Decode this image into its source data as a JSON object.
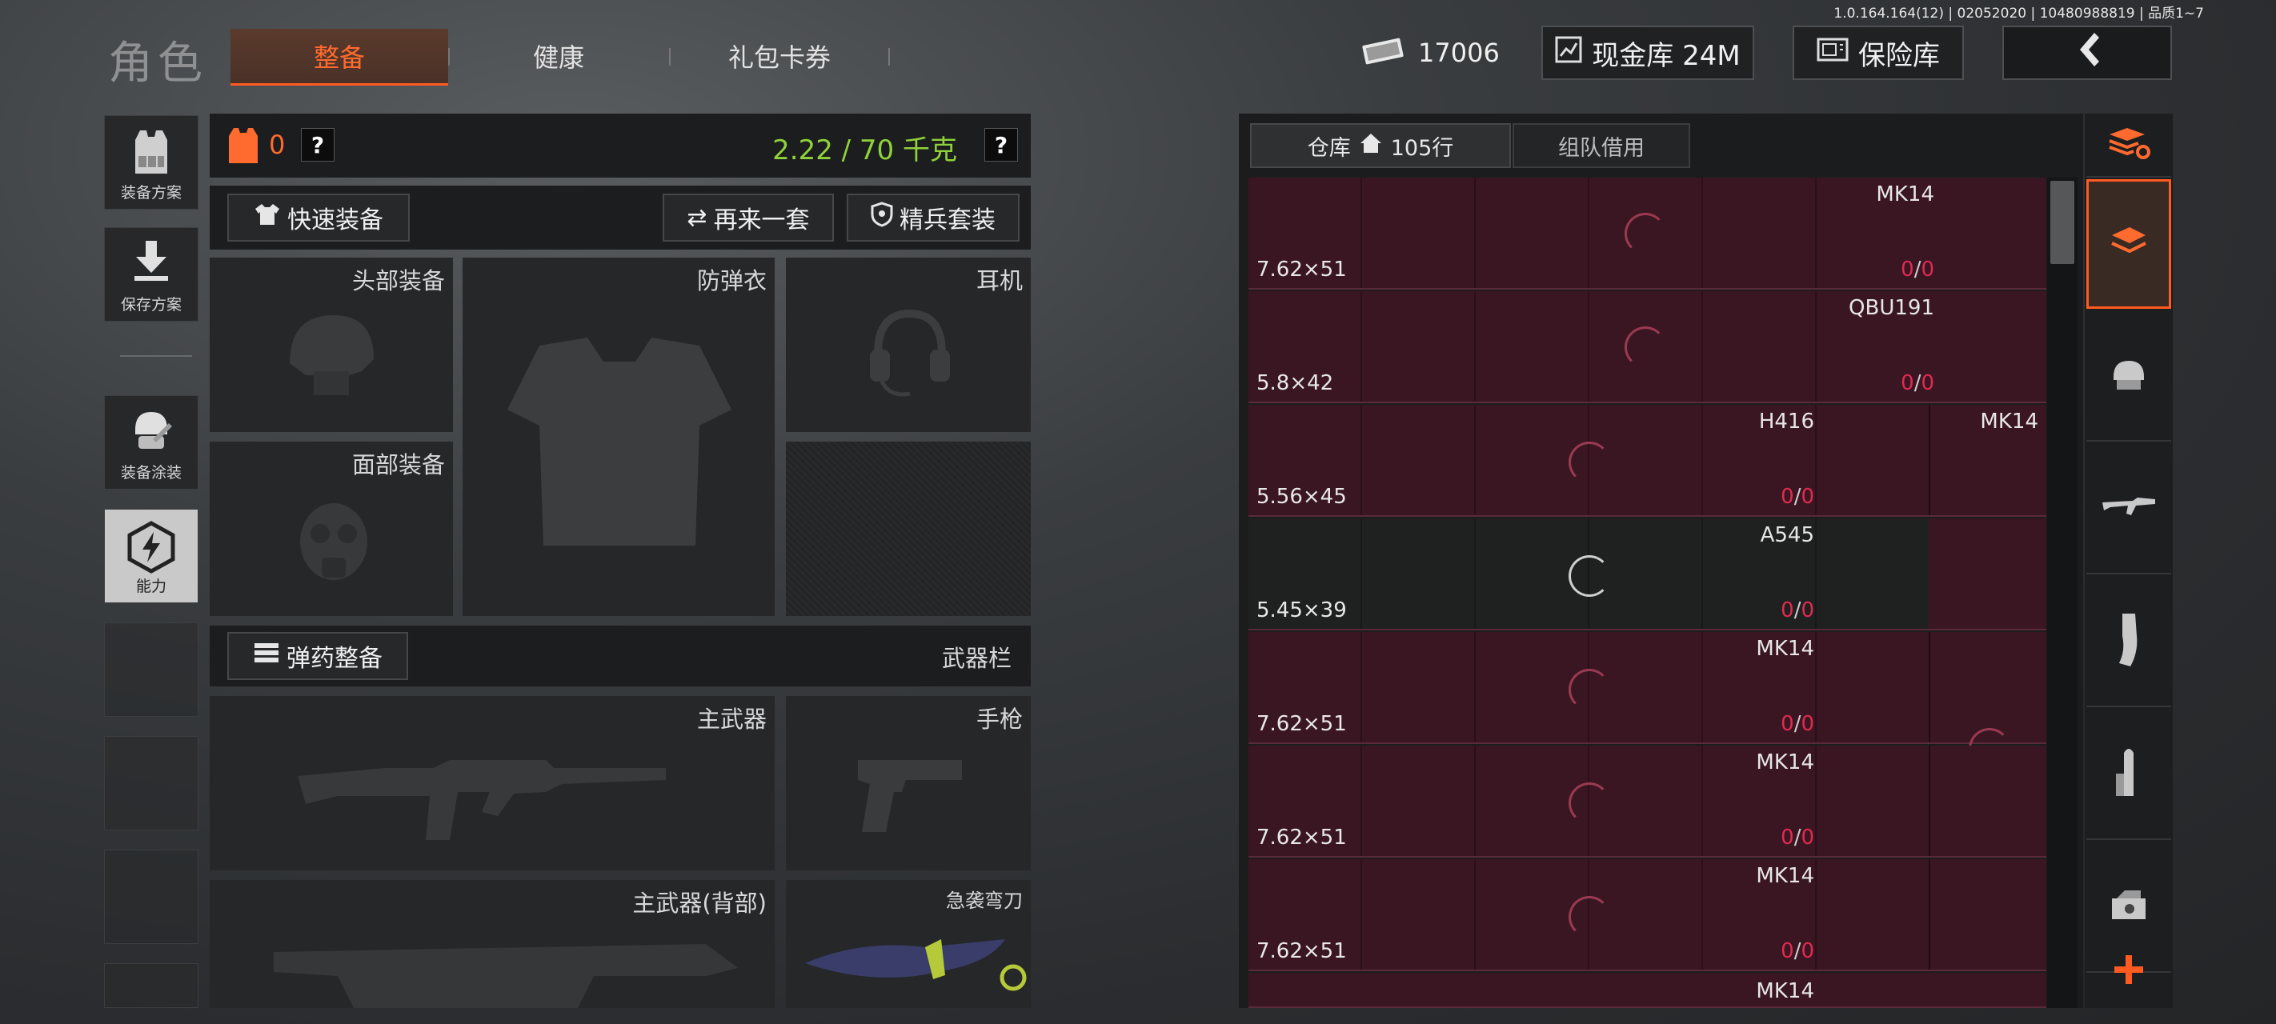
{
  "build_info": "1.0.164.164(12) | 02052020 | 10480988819 | 品质1~7",
  "header": {
    "title": "角色",
    "tabs": [
      {
        "label": "整备",
        "active": true
      },
      {
        "label": "健康",
        "active": false
      },
      {
        "label": "礼包卡券",
        "active": false
      }
    ],
    "money_value": "17006",
    "cash_vault_label": "现金库 24M",
    "safe_label": "保险库",
    "back_icon": "chevron-left-icon"
  },
  "left_nav": [
    {
      "label": "装备方案",
      "icon": "vest-icon"
    },
    {
      "label": "保存方案",
      "icon": "download-icon"
    },
    {
      "label": "装备涂装",
      "icon": "helmet-icon"
    },
    {
      "label": "能力",
      "icon": "ability-icon",
      "active": true
    }
  ],
  "loadout": {
    "armor_count": "0",
    "help": "?",
    "weight": "2.22 / 70 千克",
    "quick_equip_label": "快速装备",
    "again_label": "再来一套",
    "elite_label": "精兵套装",
    "slots": {
      "head": "头部装备",
      "vest": "防弹衣",
      "headset": "耳机",
      "face": "面部装备"
    },
    "ammo_label": "弹药整备",
    "weapon_bar_label": "武器栏",
    "weapons": {
      "primary": "主武器",
      "pistol": "手枪",
      "primary_back": "主武器(背部)",
      "knife": "急袭弯刀"
    }
  },
  "warehouse": {
    "tab_storage": "仓库",
    "rows_label": "105行",
    "tab_team": "组队借用",
    "rows": [
      {
        "caliber": "7.62×51",
        "guns": [
          "MK14"
        ],
        "count": "0",
        "max": "0"
      },
      {
        "caliber": "5.8×42",
        "guns": [
          "QBU191"
        ],
        "count": "0",
        "max": "0"
      },
      {
        "caliber": "5.56×45",
        "guns": [
          "H416",
          "MK14"
        ],
        "count": "0",
        "max": "0"
      },
      {
        "caliber": "5.45×39",
        "guns": [
          "A545"
        ],
        "count": "0",
        "max": "0"
      },
      {
        "caliber": "7.62×51",
        "guns": [
          "MK14"
        ],
        "count": "0",
        "max": "0"
      },
      {
        "caliber": "7.62×51",
        "guns": [
          "MK14"
        ],
        "count": "0",
        "max": "0"
      },
      {
        "caliber": "7.62×51",
        "guns": [
          "MK14"
        ],
        "count": "0",
        "max": "0"
      },
      {
        "caliber": "",
        "guns": [
          "MK14"
        ],
        "count": "",
        "max": ""
      }
    ]
  },
  "colors": {
    "accent": "#ff5a1f",
    "weight_green": "#8fd23a",
    "row_bg": "#3a1622",
    "count_red": "#e02a50"
  }
}
